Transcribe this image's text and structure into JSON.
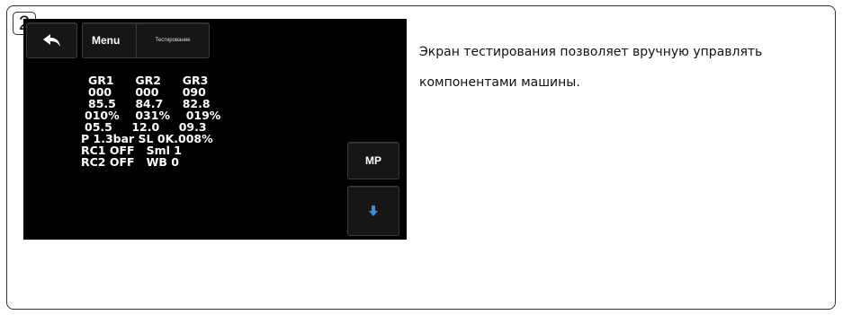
{
  "step_number": "2",
  "screen": {
    "menu_label": "Menu",
    "test_label": "Тестирование",
    "mp_label": "MP",
    "stats": {
      "headers": [
        "GR1",
        "GR2",
        "GR3"
      ],
      "row1": [
        "000",
        "000",
        "090"
      ],
      "row2": [
        "85.5",
        "84.7",
        "82.8"
      ],
      "row3": [
        "010%",
        "031%",
        "019%"
      ],
      "row4": [
        "05.5",
        "12.0",
        "09.3"
      ],
      "line_p": "P 1.3bar SL 0K.008%",
      "line_rc1": "RC1 OFF   Sml 1",
      "line_rc2": "RC2 OFF   WB 0"
    }
  },
  "description": "Экран тестирования позволяет вручную управлять компонентами машины."
}
